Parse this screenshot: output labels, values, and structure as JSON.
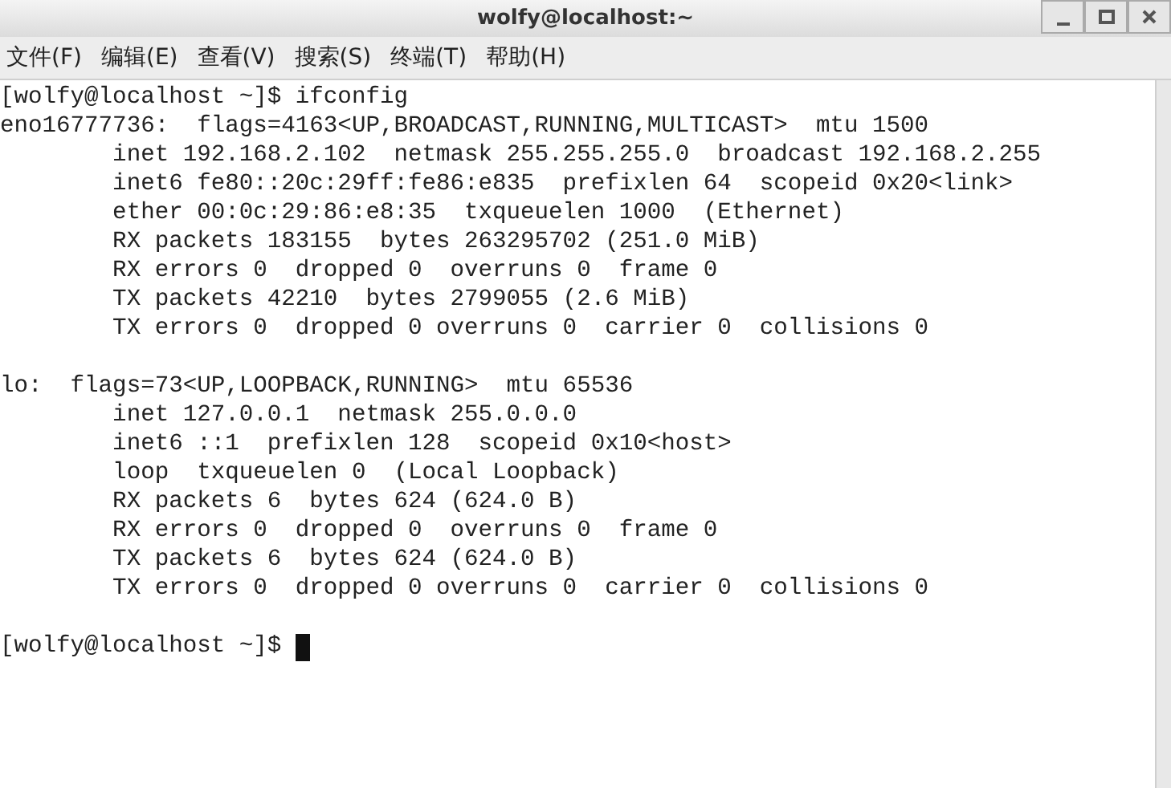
{
  "window": {
    "title": "wolfy@localhost:~"
  },
  "menu": [
    "文件(F)",
    "编辑(E)",
    "查看(V)",
    "搜索(S)",
    "终端(T)",
    "帮助(H)"
  ],
  "terminal": {
    "lines": [
      {
        "kind": "text",
        "text": "[wolfy@localhost ~]$ ifconfig",
        "cursor": false
      },
      {
        "kind": "text",
        "text": "eno16777736:  flags=4163<UP,BROADCAST,RUNNING,MULTICAST>  mtu 1500",
        "cursor": false
      },
      {
        "kind": "text",
        "text": "        inet 192.168.2.102  netmask 255.255.255.0  broadcast 192.168.2.255",
        "cursor": false
      },
      {
        "kind": "text",
        "text": "        inet6 fe80::20c:29ff:fe86:e835  prefixlen 64  scopeid 0x20<link>",
        "cursor": false
      },
      {
        "kind": "text",
        "text": "        ether 00:0c:29:86:e8:35  txqueuelen 1000  (Ethernet)",
        "cursor": false
      },
      {
        "kind": "text",
        "text": "        RX packets 183155  bytes 263295702 (251.0 MiB)",
        "cursor": false
      },
      {
        "kind": "text",
        "text": "        RX errors 0  dropped 0  overruns 0  frame 0",
        "cursor": false
      },
      {
        "kind": "text",
        "text": "        TX packets 42210  bytes 2799055 (2.6 MiB)",
        "cursor": false
      },
      {
        "kind": "text",
        "text": "        TX errors 0  dropped 0 overruns 0  carrier 0  collisions 0",
        "cursor": false
      },
      {
        "kind": "blank"
      },
      {
        "kind": "text",
        "text": "lo:  flags=73<UP,LOOPBACK,RUNNING>  mtu 65536",
        "cursor": false
      },
      {
        "kind": "text",
        "text": "        inet 127.0.0.1  netmask 255.0.0.0",
        "cursor": false
      },
      {
        "kind": "text",
        "text": "        inet6 ::1  prefixlen 128  scopeid 0x10<host>",
        "cursor": false
      },
      {
        "kind": "text",
        "text": "        loop  txqueuelen 0  (Local Loopback)",
        "cursor": false
      },
      {
        "kind": "text",
        "text": "        RX packets 6  bytes 624 (624.0 B)",
        "cursor": false
      },
      {
        "kind": "text",
        "text": "        RX errors 0  dropped 0  overruns 0  frame 0",
        "cursor": false
      },
      {
        "kind": "text",
        "text": "        TX packets 6  bytes 624 (624.0 B)",
        "cursor": false
      },
      {
        "kind": "text",
        "text": "        TX errors 0  dropped 0 overruns 0  carrier 0  collisions 0",
        "cursor": false
      },
      {
        "kind": "blank"
      },
      {
        "kind": "text",
        "text": "[wolfy@localhost ~]$ ",
        "cursor": true
      }
    ]
  }
}
